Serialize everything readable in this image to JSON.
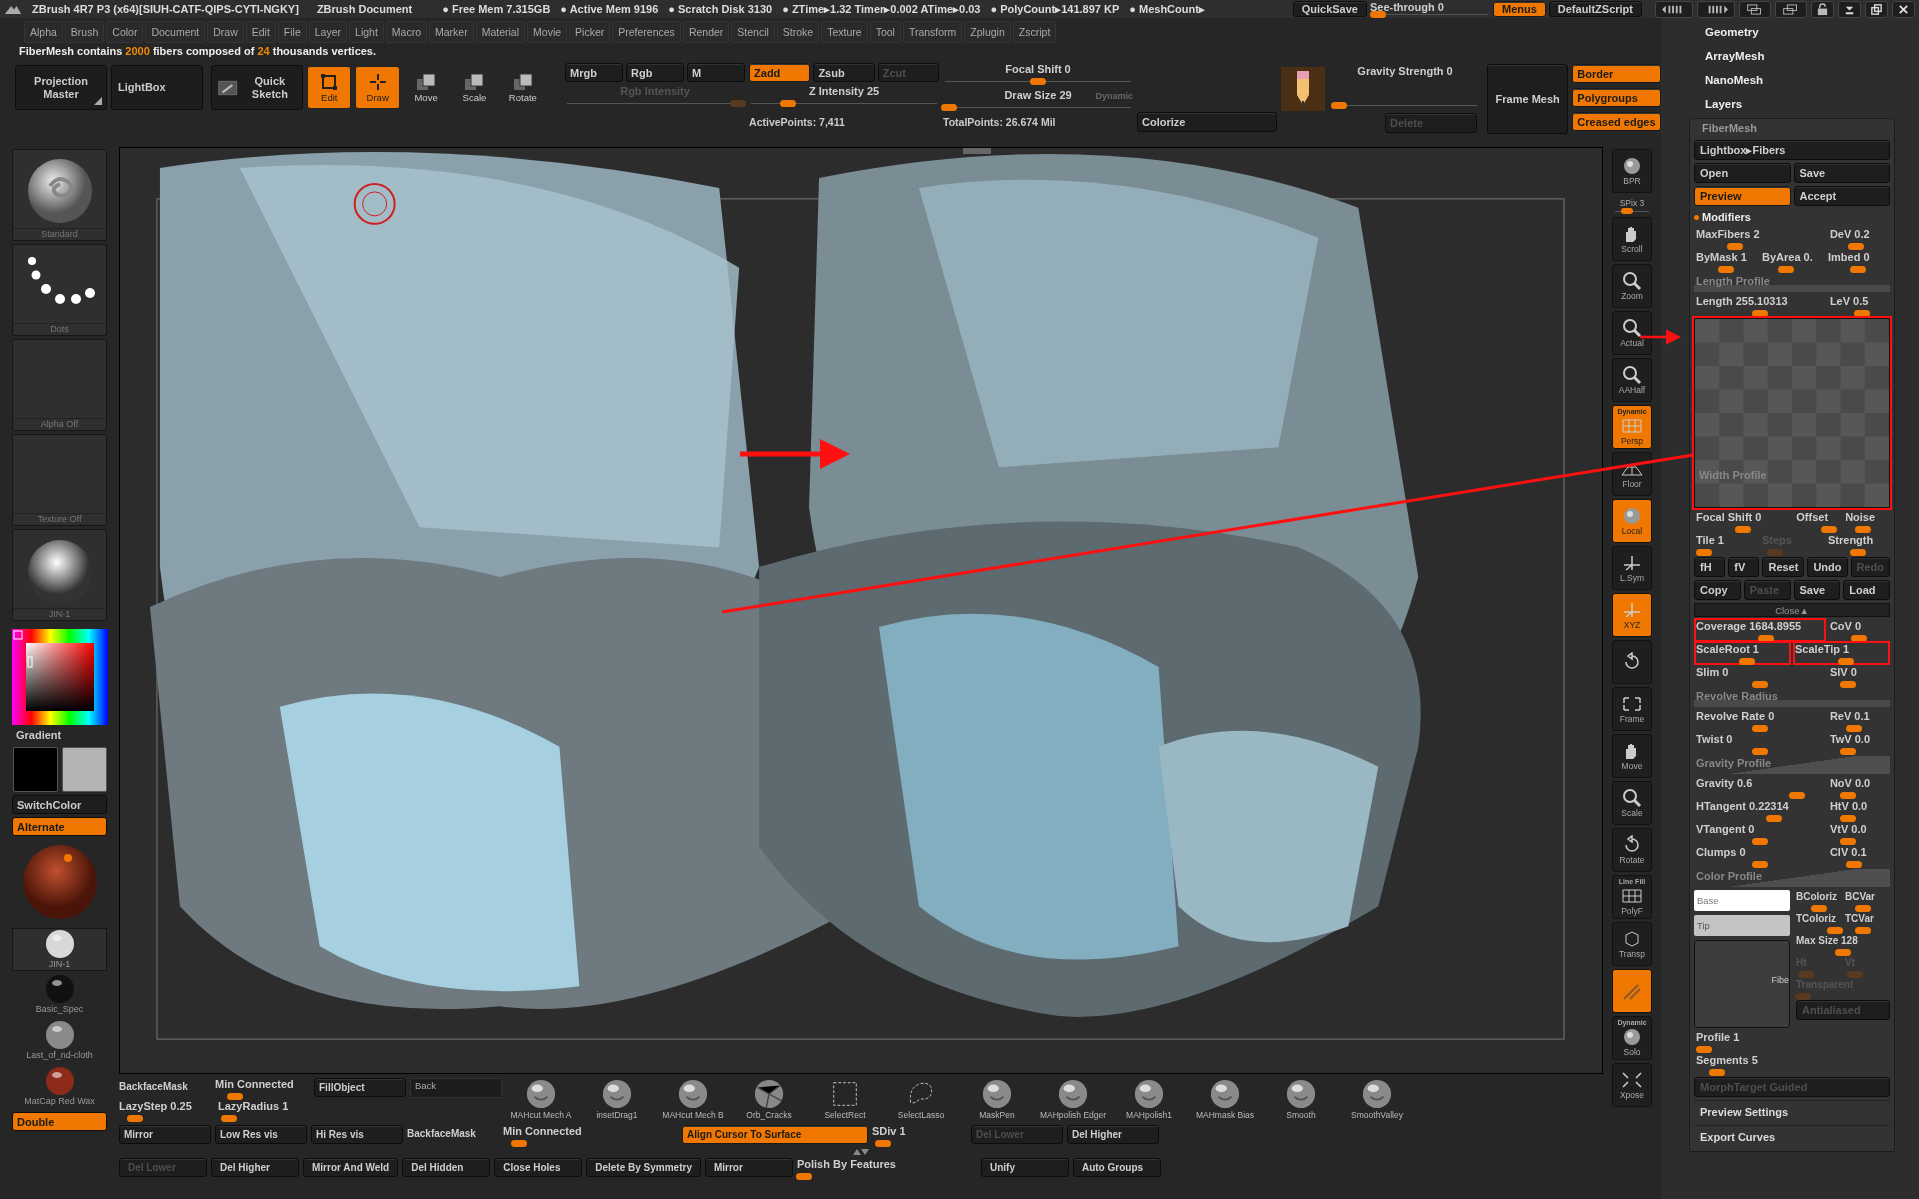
{
  "title_bar": {
    "app": "ZBrush 4R7 P3 (x64)[SIUH-CATF-QIPS-CYTI-NGKY]",
    "document": "ZBrush Document",
    "stats": [
      "● Free Mem 7.315GB",
      "● Active Mem 9196",
      "● Scratch Disk 3130",
      "● ZTime▸1.32 Timer▸0.002 ATime▸0.03",
      "● PolyCount▸141.897 KP",
      "● MeshCount▸"
    ],
    "quicksave": {
      "kind": "button",
      "label": "QuickSave"
    },
    "see_through": {
      "kind": "slider",
      "label": "See-through  0",
      "level": 0.05
    },
    "menus": {
      "kind": "button",
      "label": "Menus",
      "on": true
    },
    "script": {
      "kind": "button",
      "label": "DefaultZScript"
    }
  },
  "menu_bar": [
    "Alpha",
    "Brush",
    "Color",
    "Document",
    "Draw",
    "Edit",
    "File",
    "Layer",
    "Light",
    "Macro",
    "Marker",
    "Material",
    "Movie",
    "Picker",
    "Preferences",
    "Render",
    "Stencil",
    "Stroke",
    "Texture",
    "Tool",
    "Transform",
    "Zplugin",
    "Zscript"
  ],
  "info": [
    {
      "text": "FiberMesh contains ",
      "accent": false
    },
    {
      "text": "2000",
      "accent": true
    },
    {
      "text": " fibers composed of ",
      "accent": false
    },
    {
      "text": "24",
      "accent": true
    },
    {
      "text": " thousands vertices.",
      "accent": false
    }
  ],
  "top_shelf": {
    "tiles": [
      {
        "label": "Projection Master",
        "kind": "corner"
      },
      {
        "label": "LightBox",
        "kind": "plain"
      },
      {
        "label": "Quick Sketch",
        "kind": "sketch"
      }
    ],
    "modes": [
      {
        "label": "Edit",
        "kind": "edit",
        "on": true
      },
      {
        "label": "Draw",
        "kind": "draw",
        "on": true
      },
      {
        "label": "Move",
        "kind": "move",
        "on": false
      },
      {
        "label": "Scale",
        "kind": "scale",
        "on": false
      },
      {
        "label": "Rotate",
        "kind": "rotate",
        "on": false
      }
    ],
    "color_modes": [
      {
        "kind": "button",
        "label": "Mrgb",
        "on": false
      },
      {
        "kind": "button",
        "label": "Rgb",
        "on": false
      },
      {
        "kind": "button",
        "label": "M",
        "on": false
      }
    ],
    "rgb_intensity": {
      "kind": "slider",
      "label": "Rgb Intensity",
      "level": 0.97,
      "disabled": true
    },
    "z_modes": [
      {
        "kind": "button",
        "label": "Zadd",
        "on": true
      },
      {
        "kind": "button",
        "label": "Zsub",
        "on": false
      },
      {
        "kind": "button",
        "label": "Zcut",
        "on": false,
        "disabled": true
      }
    ],
    "z_intensity": {
      "kind": "slider",
      "label": "Z Intensity 25",
      "level": 0.2
    },
    "focal_shift": {
      "kind": "slider",
      "label": "Focal Shift 0",
      "level": 0.5
    },
    "draw_size": {
      "kind": "slider",
      "label": "Draw Size 29",
      "level": 0.02,
      "note": "Dynamic"
    },
    "active_points": "ActivePoints: 7,411",
    "total_points": "TotalPoints: 26.674 Mil",
    "colorize": {
      "kind": "button",
      "label": "Colorize"
    },
    "gravity_strength": {
      "kind": "slider",
      "label": "Gravity Strength 0",
      "level": 0.04
    },
    "delete": {
      "kind": "button",
      "label": "Delete",
      "disabled": true
    },
    "frame_mesh": {
      "kind": "button",
      "label": "Frame Mesh"
    },
    "frame_options": [
      {
        "kind": "button",
        "label": "Border",
        "on": true
      },
      {
        "kind": "button",
        "label": "Polygroups",
        "on": true
      },
      {
        "kind": "button",
        "label": "Creased edges",
        "on": true
      }
    ]
  },
  "left_column": [
    {
      "kind": "brush",
      "label": "Standard"
    },
    {
      "kind": "stroke",
      "label": "Dots"
    },
    {
      "kind": "empty",
      "label": "Alpha Off"
    },
    {
      "kind": "empty",
      "label": "Texture Off"
    },
    {
      "kind": "material",
      "label": "JIN-1"
    },
    {
      "kind": "picker"
    },
    {
      "kind": "text",
      "label": "Gradient"
    },
    {
      "kind": "swatches",
      "swatches": [
        {
          "color": "#000000"
        },
        {
          "color": "#b4b4b4"
        }
      ]
    },
    {
      "kind": "button",
      "label": "SwitchColor",
      "on": false
    },
    {
      "kind": "button",
      "label": "Alternate",
      "on": true
    },
    {
      "kind": "texsphere"
    },
    {
      "kind": "mat",
      "label": "JIN-1",
      "color": "#d8d8d8",
      "boxed": true
    },
    {
      "kind": "mat",
      "label": "Basic_Spec",
      "color": "#111111",
      "boxed": false
    },
    {
      "kind": "mat",
      "label": "Last_of_nd-cloth",
      "color": "#8a8a8a",
      "boxed": false
    },
    {
      "kind": "mat",
      "label": "MatCap Red Wax",
      "color": "#8e2a1a",
      "boxed": false
    },
    {
      "kind": "button",
      "label": "Double",
      "on": true
    }
  ],
  "toolbar": [
    {
      "kind": "sphere",
      "label": "BPR",
      "on": false
    },
    {
      "kind": "spix",
      "label": "SPix 3",
      "level": 0.35
    },
    {
      "kind": "hand",
      "label": "Scroll",
      "on": false
    },
    {
      "kind": "magnifier",
      "label": "Zoom",
      "on": false
    },
    {
      "kind": "magnifier",
      "label": "Actual",
      "on": false
    },
    {
      "kind": "magnifier",
      "label": "AAHalf",
      "on": false
    },
    {
      "kind": "grid",
      "label": "Persp",
      "sub": "Dynamic",
      "on": true
    },
    {
      "kind": "floor",
      "label": "Floor",
      "on": false
    },
    {
      "kind": "sphere",
      "label": "Local",
      "on": true
    },
    {
      "kind": "axes",
      "label": "L.Sym",
      "on": false
    },
    {
      "kind": "axes",
      "label": "XYZ",
      "on": true
    },
    {
      "kind": "rotate",
      "on": false
    },
    {
      "kind": "frame",
      "label": "Frame",
      "on": false
    },
    {
      "kind": "hand",
      "label": "Move",
      "on": false
    },
    {
      "kind": "magnifier",
      "label": "Scale",
      "on": false
    },
    {
      "kind": "rotate",
      "label": "Rotate",
      "on": false
    },
    {
      "kind": "grid",
      "label": "PolyF",
      "sub": "Line Fill",
      "on": false
    },
    {
      "kind": "cube",
      "label": "Transp",
      "on": false
    },
    {
      "kind": "ghost",
      "on": true
    },
    {
      "kind": "sphere",
      "label": "Solo",
      "sub": "Dynamic",
      "on": false
    },
    {
      "kind": "arrows",
      "label": "Xpose",
      "on": false
    }
  ],
  "right_panel": {
    "menus": [
      "Geometry",
      "ArrayMesh",
      "NanoMesh",
      "Layers"
    ],
    "fibermesh": {
      "title": "FiberMesh",
      "rows": [
        {
          "kind": "buttons",
          "items": [
            {
              "kind": "button",
              "label": "Lightbox▸Fibers"
            }
          ]
        },
        {
          "kind": "buttons",
          "items": [
            {
              "kind": "button",
              "label": "Open"
            },
            {
              "kind": "button",
              "label": "Save"
            }
          ]
        },
        {
          "kind": "buttons",
          "items": [
            {
              "kind": "button",
              "label": "Preview",
              "on": true
            },
            {
              "kind": "button",
              "label": "Accept",
              "on": false
            }
          ]
        },
        {
          "kind": "section",
          "label": "Modifiers"
        },
        {
          "kind": "sliders",
          "items": [
            {
              "kind": "slider",
              "label": "MaxFibers 2",
              "level": 0.3,
              "wide": true
            },
            {
              "kind": "slider",
              "label": "DeV 0.2",
              "level": 0.45
            }
          ]
        },
        {
          "kind": "sliders",
          "items": [
            {
              "kind": "slider",
              "label": "ByMask 1",
              "level": 0.5
            },
            {
              "kind": "slider",
              "label": "ByArea 0.",
              "level": 0.4
            },
            {
              "kind": "slider",
              "label": "Imbed 0",
              "level": 0.5
            }
          ]
        },
        {
          "kind": "profile",
          "label": "Length Profile"
        },
        {
          "kind": "sliders",
          "items": [
            {
              "kind": "slider",
              "label": "Length 255.10313",
              "level": 0.5,
              "wide": true
            },
            {
              "kind": "slider",
              "label": "LeV 0.5",
              "level": 0.55
            }
          ]
        },
        {
          "kind": "curve",
          "label": "Width Profile",
          "highlighted": true
        },
        {
          "kind": "sliders",
          "items": [
            {
              "kind": "slider",
              "label": "Focal Shift 0",
              "level": 0.5,
              "wide": true
            },
            {
              "kind": "slider",
              "label": "Offset",
              "level": 0.8
            },
            {
              "kind": "slider",
              "label": "Noise",
              "level": 0.4
            }
          ]
        },
        {
          "kind": "sliders",
          "items": [
            {
              "kind": "slider",
              "label": "Tile 1",
              "level": 0.1
            },
            {
              "kind": "slider",
              "label": "Steps",
              "level": 0.2,
              "disabled": true
            },
            {
              "kind": "slider",
              "label": "Strength",
              "level": 0.5
            }
          ]
        },
        {
          "kind": "buttons",
          "items": [
            {
              "kind": "button",
              "label": "fH"
            },
            {
              "kind": "button",
              "label": "fV"
            },
            {
              "kind": "button",
              "label": "Reset"
            },
            {
              "kind": "button",
              "label": "Undo"
            },
            {
              "kind": "button",
              "label": "Redo",
              "disabled": true
            }
          ]
        },
        {
          "kind": "buttons",
          "items": [
            {
              "kind": "button",
              "label": "Copy"
            },
            {
              "kind": "button",
              "label": "Paste",
              "disabled": true
            },
            {
              "kind": "button",
              "label": "Save"
            },
            {
              "kind": "button",
              "label": "Load"
            }
          ]
        },
        {
          "kind": "close",
          "label": "Close▲"
        },
        {
          "kind": "sliders",
          "items": [
            {
              "kind": "slider",
              "label": "Coverage 1684.8955",
              "level": 0.55,
              "wide": true,
              "highlighted": true
            },
            {
              "kind": "slider",
              "label": "CoV 0",
              "level": 0.5
            }
          ]
        },
        {
          "kind": "sliders",
          "items": [
            {
              "kind": "slider",
              "label": "ScaleRoot 1",
              "level": 0.55,
              "highlighted": true
            },
            {
              "kind": "slider",
              "label": "ScaleTip 1",
              "level": 0.55,
              "highlighted": true
            }
          ]
        },
        {
          "kind": "sliders",
          "items": [
            {
              "kind": "slider",
              "label": "Slim 0",
              "level": 0.5,
              "wide": true
            },
            {
              "kind": "slider",
              "label": "SlV 0",
              "level": 0.3
            }
          ]
        },
        {
          "kind": "profile",
          "label": "Revolve Radius"
        },
        {
          "kind": "sliders",
          "items": [
            {
              "kind": "slider",
              "label": "Revolve Rate 0",
              "level": 0.5,
              "wide": true
            },
            {
              "kind": "slider",
              "label": "ReV 0.1",
              "level": 0.4
            }
          ]
        },
        {
          "kind": "sliders",
          "items": [
            {
              "kind": "slider",
              "label": "Twist 0",
              "level": 0.5,
              "wide": true
            },
            {
              "kind": "slider",
              "label": "TwV 0.0",
              "level": 0.3
            }
          ]
        },
        {
          "kind": "ramp",
          "label": "Gravity Profile"
        },
        {
          "kind": "sliders",
          "items": [
            {
              "kind": "slider",
              "label": "Gravity 0.6",
              "level": 0.8,
              "wide": true
            },
            {
              "kind": "slider",
              "label": "NoV 0.0",
              "level": 0.3
            }
          ]
        },
        {
          "kind": "sliders",
          "items": [
            {
              "kind": "slider",
              "label": "HTangent 0.22314",
              "level": 0.61,
              "wide": true
            },
            {
              "kind": "slider",
              "label": "HtV 0.0",
              "level": 0.3
            }
          ]
        },
        {
          "kind": "sliders",
          "items": [
            {
              "kind": "slider",
              "label": "VTangent 0",
              "level": 0.5,
              "wide": true
            },
            {
              "kind": "slider",
              "label": "VtV 0.0",
              "level": 0.3
            }
          ]
        },
        {
          "kind": "sliders",
          "items": [
            {
              "kind": "slider",
              "label": "Clumps 0",
              "level": 0.5,
              "wide": true
            },
            {
              "kind": "slider",
              "label": "ClV 0.1",
              "level": 0.4
            }
          ]
        },
        {
          "kind": "ramp",
          "label": "Color Profile"
        },
        {
          "kind": "color",
          "base": "Base",
          "tip": "Tip",
          "preview": "Fibe",
          "sliders": [
            {
              "kind": "slider",
              "label": "BColoriz",
              "level": 0.5
            },
            {
              "kind": "slider",
              "label": "BCVar",
              "level": 0.4
            },
            {
              "kind": "slider",
              "label": "TColoriz",
              "level": 0.9
            },
            {
              "kind": "slider",
              "label": "TCVar",
              "level": 0.4
            },
            {
              "kind": "slider",
              "label": "Max Size 128",
              "level": 0.5,
              "wide": true
            },
            {
              "kind": "slider",
              "label": "Ht",
              "level": 0.2,
              "disabled": true
            },
            {
              "kind": "slider",
              "label": "Vt",
              "level": 0.2,
              "disabled": true
            },
            {
              "kind": "slider",
              "label": "Transparent",
              "level": 0.05,
              "disabled": true
            }
          ],
          "antialiased": {
            "kind": "button",
            "label": "Antialiased",
            "disabled": true
          }
        },
        {
          "kind": "sliders",
          "items": [
            {
              "kind": "slider",
              "label": "Profile 1",
              "level": 0.03
            }
          ]
        },
        {
          "kind": "sliders",
          "items": [
            {
              "kind": "slider",
              "label": "Segments 5",
              "level": 0.1
            }
          ]
        },
        {
          "kind": "buttons",
          "items": [
            {
              "kind": "button",
              "label": "MorphTarget Guided",
              "disabled": true
            }
          ]
        },
        {
          "kind": "menu",
          "label": "Preview Settings"
        },
        {
          "kind": "menu",
          "label": "Export Curves"
        }
      ]
    }
  },
  "bottom_shelf": {
    "block": [
      [
        {
          "kind": "label",
          "label": "BackfaceMask"
        },
        {
          "kind": "slider",
          "label": "Min Connected",
          "level": 0.2
        },
        {
          "kind": "button",
          "label": "FillObject"
        },
        {
          "kind": "field",
          "label": "Back"
        }
      ],
      [
        {
          "kind": "slider",
          "label": "LazyStep 0.25",
          "level": 0.15
        },
        {
          "kind": "slider",
          "label": "LazyRadius 1",
          "level": 0.1
        }
      ]
    ],
    "brushes": [
      {
        "kind": "sphere",
        "label": "MAHcut Mech A"
      },
      {
        "kind": "sphere",
        "label": "insetDrag1"
      },
      {
        "kind": "sphere",
        "label": "MAHcut Mech B"
      },
      {
        "kind": "cracked",
        "label": "Orb_Cracks"
      },
      {
        "kind": "rect",
        "label": "SelectRect"
      },
      {
        "kind": "lasso",
        "label": "SelectLasso"
      },
      {
        "kind": "sphere",
        "label": "MaskPen"
      },
      {
        "kind": "sphere",
        "label": "MAHpolish Edger"
      },
      {
        "kind": "sphere",
        "label": "MAHpolish1"
      },
      {
        "kind": "sphere",
        "label": "MAHmask Bias"
      },
      {
        "kind": "sphere",
        "label": "Smooth"
      },
      {
        "kind": "sphere",
        "label": "SmoothValley"
      }
    ],
    "row3": [
      {
        "kind": "button",
        "label": "Mirror"
      },
      {
        "kind": "button",
        "label": "Low Res vis"
      },
      {
        "kind": "button",
        "label": "Hi Res vis"
      },
      {
        "kind": "label",
        "label": "BackfaceMask"
      },
      {
        "kind": "slider",
        "label": "Min Connected",
        "level": 0.15
      },
      {
        "kind": "button",
        "label": "Align Cursor To Surface",
        "on": true
      },
      {
        "kind": "slider",
        "label": "SDiv 1",
        "level": 0.1
      },
      {
        "kind": "button",
        "label": "Del Lower",
        "disabled": true
      },
      {
        "kind": "button",
        "label": "Del Higher"
      }
    ],
    "row4": [
      {
        "kind": "button",
        "label": "Del Lower",
        "disabled": true
      },
      {
        "kind": "button",
        "label": "Del Higher"
      },
      {
        "kind": "button",
        "label": "Mirror And Weld"
      },
      {
        "kind": "button",
        "label": "Del Hidden"
      },
      {
        "kind": "button",
        "label": "Close Holes"
      },
      {
        "kind": "button",
        "label": "Delete By Symmetry"
      },
      {
        "kind": "button",
        "label": "Mirror"
      },
      {
        "kind": "slider",
        "label": "Polish By Features",
        "level": 0.03
      },
      {
        "kind": "button",
        "label": "Unify"
      },
      {
        "kind": "button",
        "label": "Auto Groups"
      }
    ]
  }
}
